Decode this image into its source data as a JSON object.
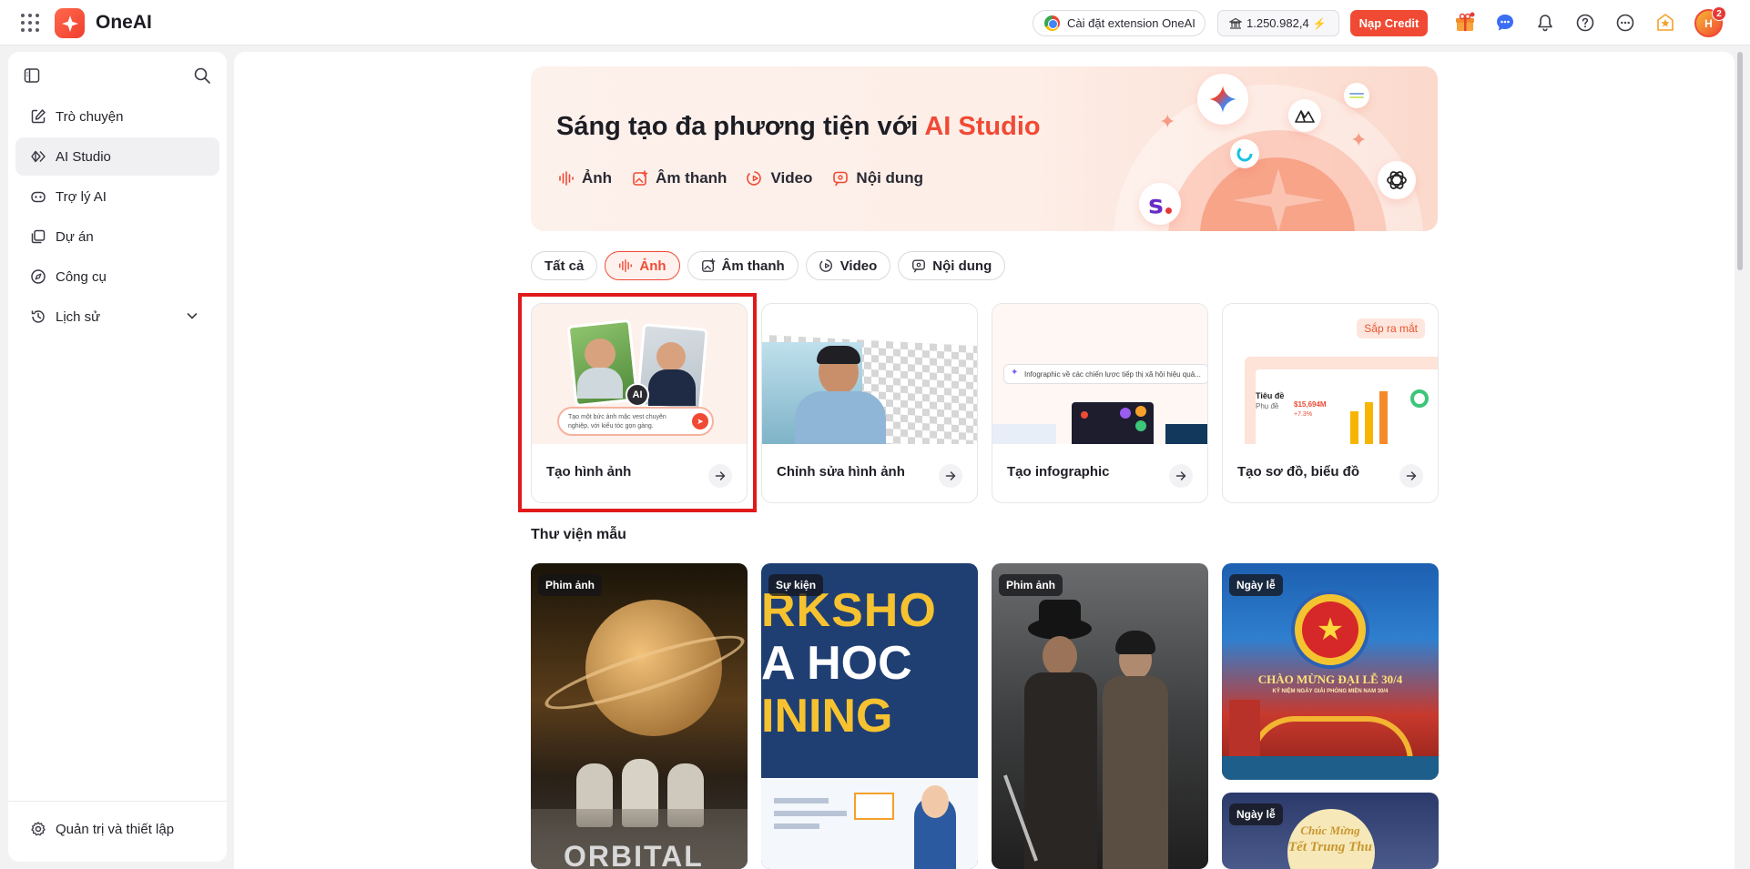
{
  "app": {
    "brand": "OneAI",
    "extension_label": "Cài đặt extension OneAI",
    "credit_balance": "1.250.982,4",
    "topup_label": "Nạp Credit",
    "avatar_initials": "H",
    "notification_count": "2"
  },
  "sidebar": {
    "items": [
      {
        "label": "Trò chuyện",
        "icon": "edit-icon"
      },
      {
        "label": "AI Studio",
        "icon": "studio-icon",
        "active": true
      },
      {
        "label": "Trợ lý AI",
        "icon": "bot-icon"
      },
      {
        "label": "Dự án",
        "icon": "folder-icon"
      },
      {
        "label": "Công cụ",
        "icon": "compass-icon"
      },
      {
        "label": "Lịch sử",
        "icon": "history-icon"
      }
    ],
    "footer_label": "Quản trị và thiết lập"
  },
  "hero": {
    "title": "Sáng tạo đa phương tiện với ",
    "title_accent": "AI Studio",
    "links": [
      "Ảnh",
      "Âm thanh",
      "Video",
      "Nội dung"
    ]
  },
  "filters": {
    "all": "Tất cả",
    "image": "Ảnh",
    "audio": "Âm thanh",
    "video": "Video",
    "content": "Nội dung"
  },
  "tools": [
    {
      "label": "Tạo hình ảnh",
      "thumb_ai": "AI",
      "thumb_prompt": "Tạo một bức ảnh mặc vest chuyên nghiệp, với kiểu tóc gọn gàng."
    },
    {
      "label": "Chỉnh sửa hình ảnh"
    },
    {
      "label": "Tạo infographic",
      "thumb_prompt": "Infographic về các chiến lược tiếp thị xã hội hiệu quả..."
    },
    {
      "label": "Tạo sơ đồ, biểu đồ",
      "badge": "Sắp ra mắt",
      "thumb_title": "Tiêu đề",
      "thumb_sub": "Phụ đề",
      "thumb_value": "$15,694M",
      "thumb_change": "+7.3%"
    }
  ],
  "library": {
    "title": "Thư viện mẫu",
    "cards": [
      {
        "badge": "Phim ảnh",
        "text": "ORBITAL"
      },
      {
        "badge": "Sự kiện",
        "text_lines": [
          "RKSHO",
          "A HOC",
          "INING"
        ]
      },
      {
        "badge": "Phim ảnh"
      },
      {
        "badge": "Ngày lễ",
        "text": "CHÀO MỪNG ĐẠI LỄ 30/4",
        "subtext": "KỶ NIỆM NGÀY GIẢI PHÓNG MIỀN NAM 30/4"
      },
      {
        "badge": "Ngày lễ",
        "text_lines": [
          "Chúc Mừng",
          "Tết Trung Thu"
        ]
      }
    ]
  },
  "colors": {
    "accent": "#f04a35",
    "highlight": "#e01919"
  }
}
